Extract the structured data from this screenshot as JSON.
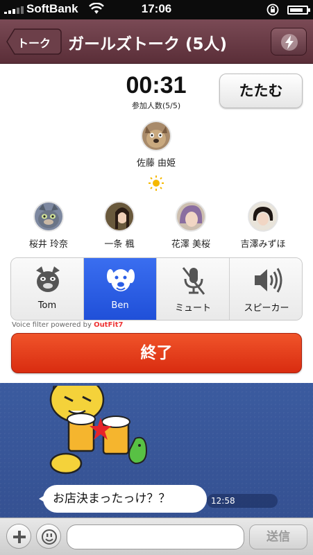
{
  "status_bar": {
    "carrier": "SoftBank",
    "time": "17:06"
  },
  "nav": {
    "back_label": "トーク",
    "title": "ガールズトーク (5人)",
    "right_icon": "lightning-icon"
  },
  "call": {
    "timer": "00:31",
    "participants_label": "参加人数(5/5)",
    "fold_label": "たたむ",
    "host": {
      "name": "佐藤 由姫",
      "icon": "dog-avatar"
    },
    "members": [
      {
        "name": "桜井 玲奈",
        "icon": "cat-avatar"
      },
      {
        "name": "一条 楓",
        "icon": "woman-avatar"
      },
      {
        "name": "花澤 美桜",
        "icon": "woman-avatar"
      },
      {
        "name": "吉澤みずほ",
        "icon": "woman-avatar"
      }
    ],
    "controls": [
      {
        "label": "Tom",
        "icon": "cat-face-icon",
        "active": false
      },
      {
        "label": "Ben",
        "icon": "dog-face-icon",
        "active": true
      },
      {
        "label": "ミュート",
        "icon": "mic-off-icon",
        "active": false
      },
      {
        "label": "スピーカー",
        "icon": "speaker-icon",
        "active": false
      }
    ],
    "powered_by": "Voice filter powered by",
    "powered_brand": "OutFit7",
    "end_label": "終了"
  },
  "chat": {
    "message": "お店決まったっけ？？",
    "time": "12:58"
  },
  "input_bar": {
    "placeholder": "",
    "send_label": "送信"
  },
  "colors": {
    "nav": "#6a3c47",
    "active_control": "#2a5de6",
    "end_button": "#e33e1c",
    "chat_bg": "#3a5aa0"
  }
}
